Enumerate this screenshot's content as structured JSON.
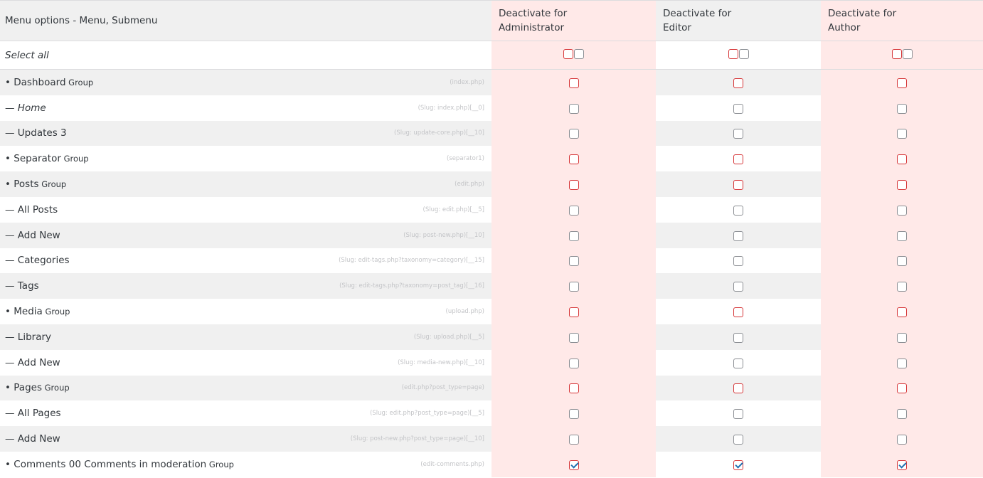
{
  "header": {
    "title": "Menu options - Menu, Submenu",
    "roles": [
      "Deactivate for Administrator",
      "Deactivate for Editor",
      "Deactivate for Author"
    ],
    "role_lines": [
      [
        "Deactivate for",
        "Administrator"
      ],
      [
        "Deactivate for",
        "Editor"
      ],
      [
        "Deactivate for",
        "Author"
      ]
    ]
  },
  "select_all": "Select all",
  "rows": [
    {
      "prefix": "• ",
      "name": "Dashboard",
      "suffix": " Group",
      "italic": false,
      "slug": "(index.php)",
      "group": true,
      "checked": false
    },
    {
      "prefix": "— ",
      "name": "Home",
      "suffix": "",
      "italic": true,
      "slug": "(Slug: index.php)[__0]",
      "group": false,
      "checked": false
    },
    {
      "prefix": "— ",
      "name": "Updates 3",
      "suffix": "",
      "italic": false,
      "slug": "(Slug: update-core.php)[__10]",
      "group": false,
      "checked": false
    },
    {
      "prefix": "• ",
      "name": "Separator",
      "suffix": " Group",
      "italic": false,
      "slug": "(separator1)",
      "group": true,
      "checked": false
    },
    {
      "prefix": "• ",
      "name": "Posts",
      "suffix": " Group",
      "italic": false,
      "slug": "(edit.php)",
      "group": true,
      "checked": false
    },
    {
      "prefix": "— ",
      "name": "All Posts",
      "suffix": "",
      "italic": false,
      "slug": "(Slug: edit.php)[__5]",
      "group": false,
      "checked": false
    },
    {
      "prefix": "— ",
      "name": "Add New",
      "suffix": "",
      "italic": false,
      "slug": "(Slug: post-new.php)[__10]",
      "group": false,
      "checked": false
    },
    {
      "prefix": "— ",
      "name": "Categories",
      "suffix": "",
      "italic": false,
      "slug": "(Slug: edit-tags.php?taxonomy=category)[__15]",
      "group": false,
      "checked": false
    },
    {
      "prefix": "— ",
      "name": "Tags",
      "suffix": "",
      "italic": false,
      "slug": "(Slug: edit-tags.php?taxonomy=post_tag)[__16]",
      "group": false,
      "checked": false
    },
    {
      "prefix": "• ",
      "name": "Media",
      "suffix": " Group",
      "italic": false,
      "slug": "(upload.php)",
      "group": true,
      "checked": false
    },
    {
      "prefix": "— ",
      "name": "Library",
      "suffix": "",
      "italic": false,
      "slug": "(Slug: upload.php)[__5]",
      "group": false,
      "checked": false
    },
    {
      "prefix": "— ",
      "name": "Add New",
      "suffix": "",
      "italic": false,
      "slug": "(Slug: media-new.php)[__10]",
      "group": false,
      "checked": false
    },
    {
      "prefix": "• ",
      "name": "Pages",
      "suffix": " Group",
      "italic": false,
      "slug": "(edit.php?post_type=page)",
      "group": true,
      "checked": false
    },
    {
      "prefix": "— ",
      "name": "All Pages",
      "suffix": "",
      "italic": false,
      "slug": "(Slug: edit.php?post_type=page)[__5]",
      "group": false,
      "checked": false
    },
    {
      "prefix": "— ",
      "name": "Add New",
      "suffix": "",
      "italic": false,
      "slug": "(Slug: post-new.php?post_type=page)[__10]",
      "group": false,
      "checked": false
    },
    {
      "prefix": "• ",
      "name": "Comments 00 Comments in moderation",
      "suffix": " Group",
      "italic": false,
      "slug": "(edit-comments.php)",
      "group": true,
      "checked": true
    }
  ]
}
